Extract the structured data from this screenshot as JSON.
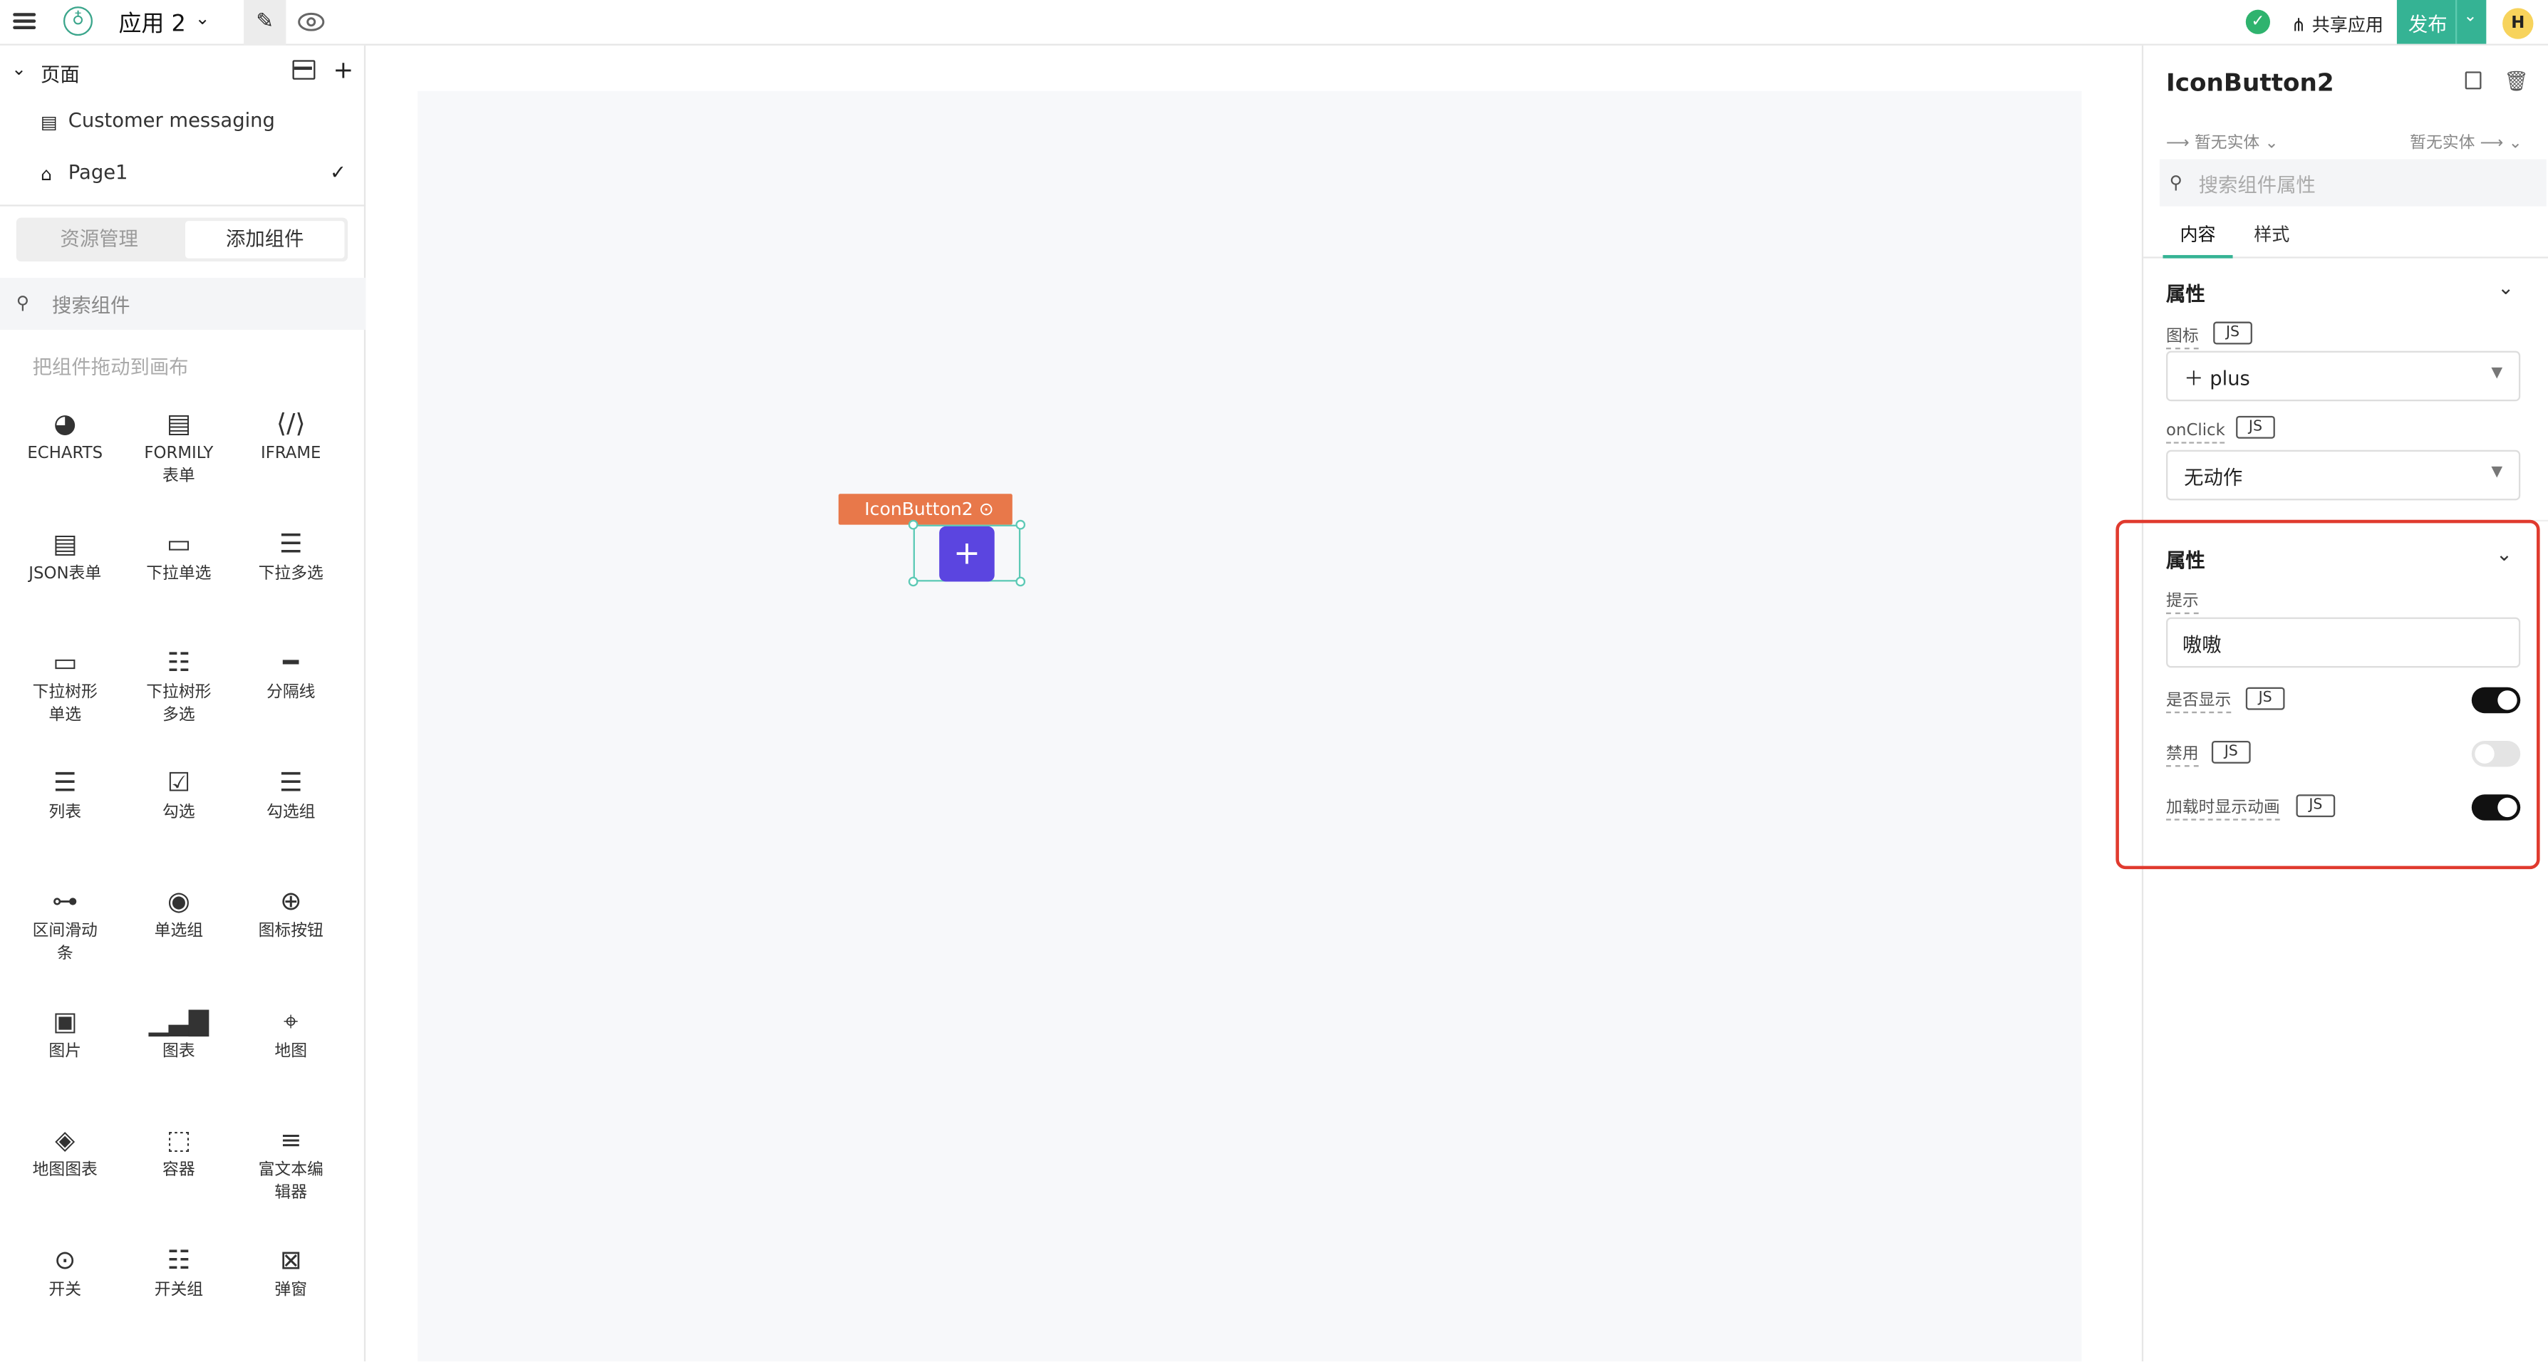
{
  "topbar": {
    "app_name": "应用 2",
    "share_label": "共享应用",
    "publish_label": "发布",
    "avatar_initial": "H",
    "accent_color": "#35b394"
  },
  "pages": {
    "title": "页面",
    "items": [
      {
        "label": "Customer messaging",
        "icon": "page-doc-icon"
      },
      {
        "label": "Page1",
        "icon": "home-icon",
        "selected": true
      }
    ]
  },
  "left_tabs": {
    "resources": "资源管理",
    "add_component": "添加组件"
  },
  "component_search": {
    "placeholder": "搜索组件"
  },
  "drag_hint": "把组件拖动到画布",
  "components": [
    {
      "label": "ECHARTS",
      "icon": "echarts-icon"
    },
    {
      "label": "FORMILY\n表单",
      "icon": "formily-icon"
    },
    {
      "label": "IFRAME",
      "icon": "iframe-icon"
    },
    {
      "label": "JSON表单",
      "icon": "json-form-icon"
    },
    {
      "label": "下拉单选",
      "icon": "select-icon"
    },
    {
      "label": "下拉多选",
      "icon": "multi-select-icon"
    },
    {
      "label": "下拉树形\n单选",
      "icon": "tree-select-icon"
    },
    {
      "label": "下拉树形\n多选",
      "icon": "tree-multi-select-icon"
    },
    {
      "label": "分隔线",
      "icon": "divider-icon"
    },
    {
      "label": "列表",
      "icon": "list-icon"
    },
    {
      "label": "勾选",
      "icon": "checkbox-icon"
    },
    {
      "label": "勾选组",
      "icon": "checkbox-group-icon"
    },
    {
      "label": "区间滑动\n条",
      "icon": "range-slider-icon"
    },
    {
      "label": "单选组",
      "icon": "radio-group-icon"
    },
    {
      "label": "图标按钮",
      "icon": "icon-button-icon"
    },
    {
      "label": "图片",
      "icon": "image-icon"
    },
    {
      "label": "图表",
      "icon": "chart-icon"
    },
    {
      "label": "地图",
      "icon": "map-pin-icon"
    },
    {
      "label": "地图图表",
      "icon": "map-chart-icon"
    },
    {
      "label": "容器",
      "icon": "container-icon"
    },
    {
      "label": "富文本编\n辑器",
      "icon": "rich-text-icon"
    },
    {
      "label": "开关",
      "icon": "switch-icon"
    },
    {
      "label": "开关组",
      "icon": "switch-group-icon"
    },
    {
      "label": "弹窗",
      "icon": "modal-icon"
    }
  ],
  "canvas": {
    "selected_component": "IconButton2",
    "button_glyph": "+"
  },
  "inspector": {
    "title": "IconButton2",
    "entity_left": "暂无实体",
    "entity_right": "暂无实体",
    "search_placeholder": "搜索组件属性",
    "tabs": [
      "内容",
      "样式"
    ],
    "section1": {
      "title": "属性",
      "icon_label": "图标",
      "icon_value": "plus",
      "onclick_label": "onClick",
      "onclick_value": "无动作",
      "js": "JS"
    },
    "section2": {
      "title": "属性",
      "tooltip_label": "提示",
      "tooltip_value": "嗷嗷",
      "visible_label": "是否显示",
      "visible": true,
      "disabled_label": "禁用",
      "disabled": false,
      "loading_label": "加载时显示动画",
      "loading": true,
      "js": "JS"
    }
  }
}
